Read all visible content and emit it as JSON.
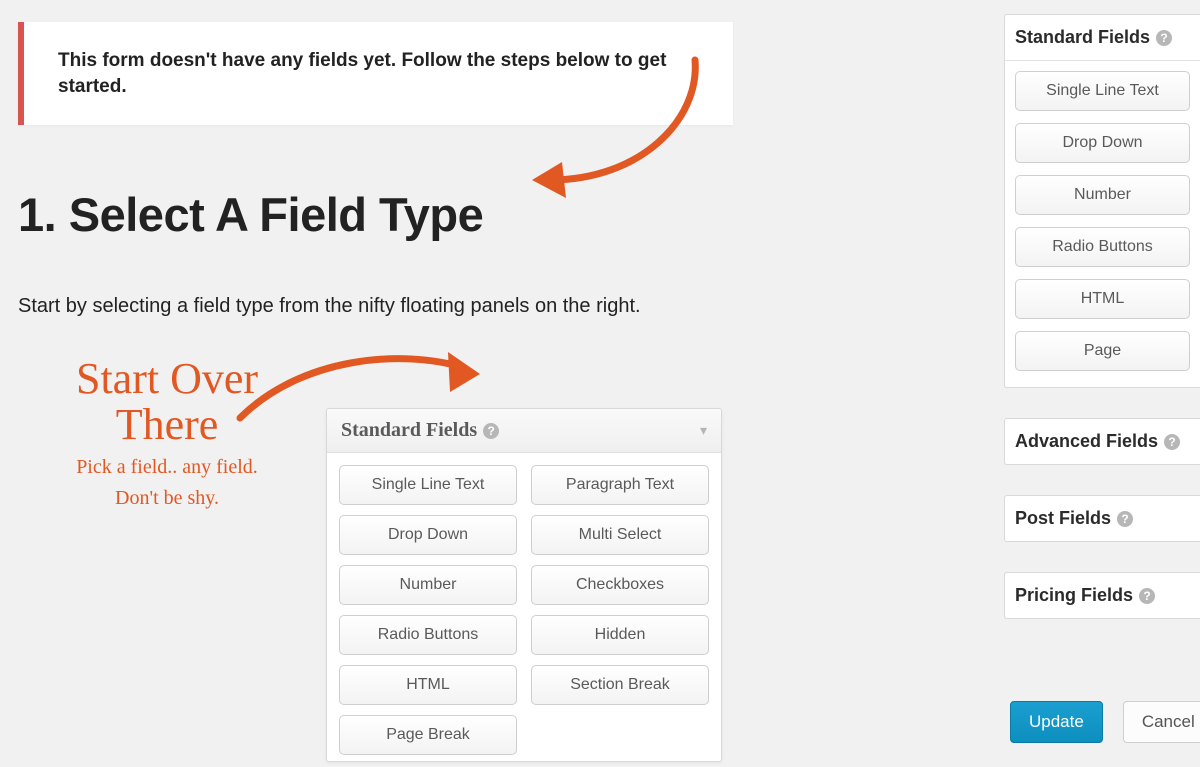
{
  "notice": {
    "message": "This form doesn't have any fields yet. Follow the steps below to get started."
  },
  "step": {
    "heading": "1. Select A Field Type",
    "description": "Start by selecting a field type from the nifty floating panels on the right."
  },
  "annotation": {
    "line1": "Start Over",
    "line2": "There",
    "sub1": "Pick a field.. any field.",
    "sub2": "Don't be shy."
  },
  "example_panel": {
    "title": "Standard Fields",
    "fields_left": [
      "Single Line Text",
      "Drop Down",
      "Number",
      "Radio Buttons",
      "HTML",
      "Page Break"
    ],
    "fields_right": [
      "Paragraph Text",
      "Multi Select",
      "Checkboxes",
      "Hidden",
      "Section Break"
    ]
  },
  "sidebar": {
    "standard": {
      "title": "Standard Fields",
      "fields": [
        "Single Line Text",
        "Drop Down",
        "Number",
        "Radio Buttons",
        "HTML",
        "Page"
      ]
    },
    "advanced": {
      "title": "Advanced Fields"
    },
    "post": {
      "title": "Post Fields"
    },
    "pricing": {
      "title": "Pricing Fields"
    }
  },
  "actions": {
    "update": "Update",
    "cancel": "Cancel"
  },
  "colors": {
    "accent_orange": "#e25822",
    "notice_border": "#d9534f",
    "primary_btn": "#0d8fbf"
  }
}
